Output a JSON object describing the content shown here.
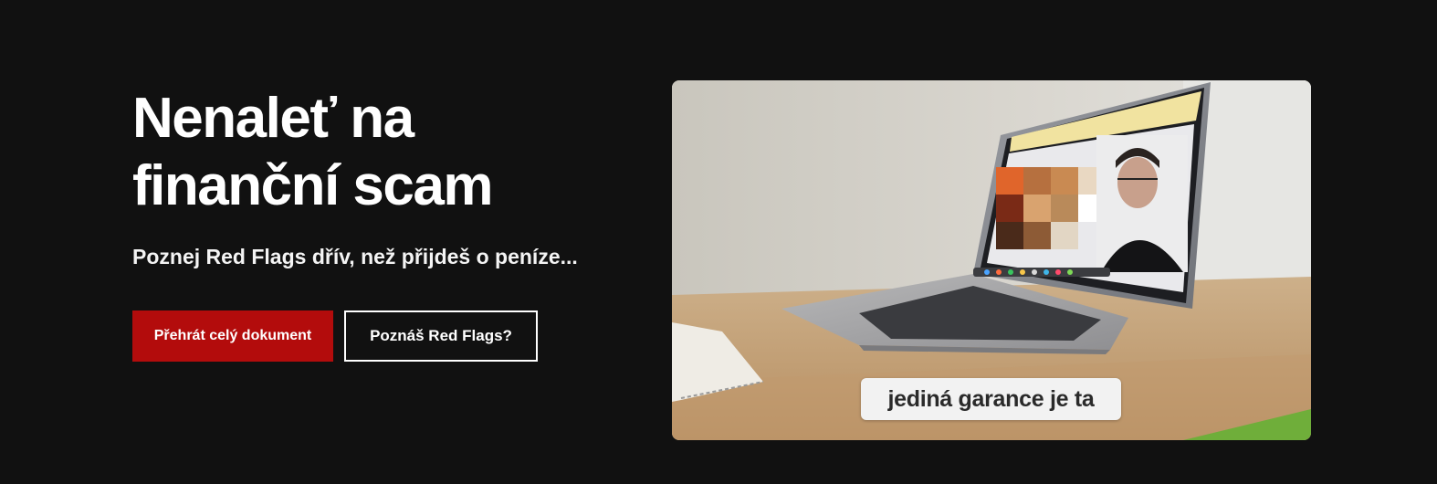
{
  "hero": {
    "title": "Nenaleť na\nfinanční scam",
    "subtitle": "Poznej Red Flags dřív, než přijdeš o peníze...",
    "primary_button": "Přehrát celý dokument",
    "secondary_button": "Poznáš Red Flags?"
  },
  "video": {
    "caption": "jediná garance je ta"
  },
  "colors": {
    "background": "#111111",
    "accent": "#b30c0c",
    "text": "#ffffff"
  }
}
